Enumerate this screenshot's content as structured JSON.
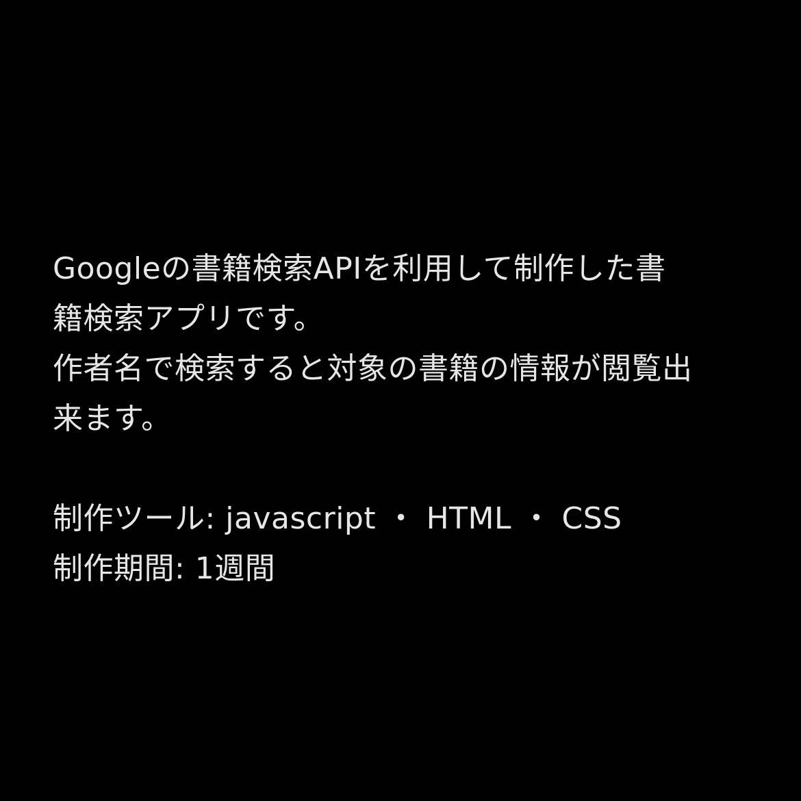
{
  "description": {
    "lines": [
      "Googleの書籍検索APIを利用して制作した書",
      "籍検索アプリです。",
      "作者名で検索すると対象の書籍の情報が閲覧出",
      "来ます。"
    ]
  },
  "details": {
    "tools": "制作ツール: javascript ・ HTML ・ CSS",
    "period": "制作期間: 1週間"
  }
}
